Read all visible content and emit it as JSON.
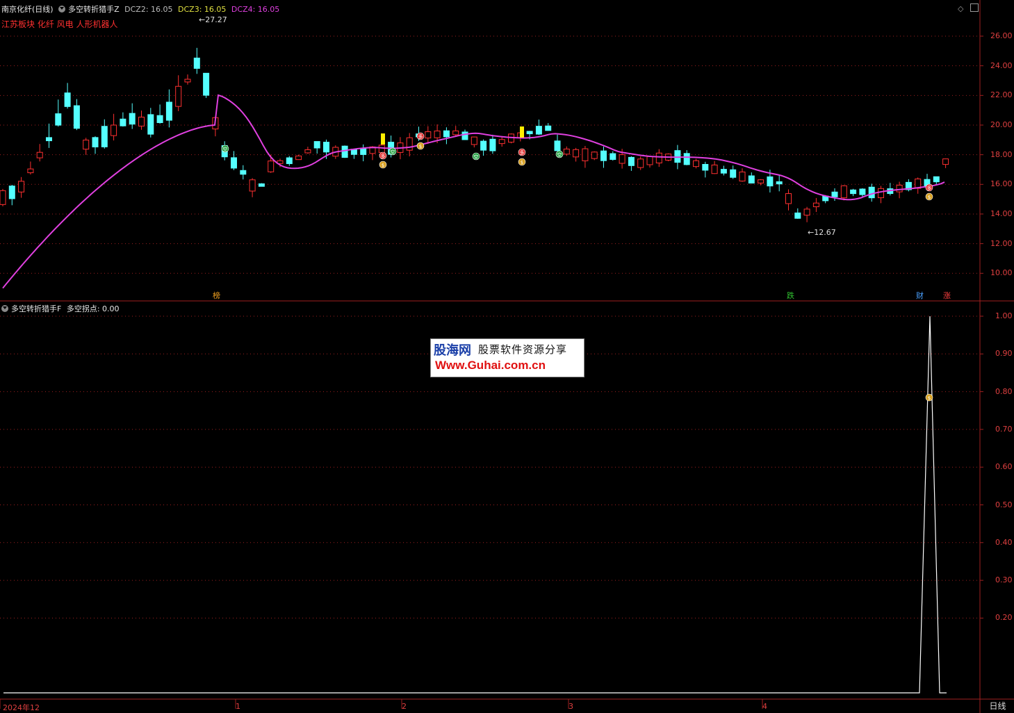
{
  "main_panel": {
    "stock_title": "南京化纤(日线)",
    "indicator_name": "多空转折猎手Z",
    "dcz2": "DCZ2: 16.05",
    "dcz3": "DCZ3: 16.05",
    "dcz4": "DCZ4: 16.05",
    "sector_text": "江苏板块 化纤 风电 人形机器人",
    "high_mark": "27.27",
    "low_mark": "12.67",
    "y_ticks": [
      "26.00",
      "24.00",
      "22.00",
      "20.00",
      "18.00",
      "16.00",
      "14.00",
      "12.00",
      "10.00"
    ],
    "bottom_badges": [
      {
        "text": "榜",
        "color": "#f0a020"
      },
      {
        "text": "跌",
        "color": "#30c030"
      },
      {
        "text": "财",
        "color": "#4aa0ff"
      },
      {
        "text": "涨",
        "color": "#ff4040"
      }
    ],
    "signal_labels": {
      "kong": "空",
      "duo": "多",
      "money": "$"
    }
  },
  "sub_panel": {
    "indicator_name": "多空转折猎手F",
    "value_label": "多空拐点: 0.00",
    "y_ticks": [
      "1.00",
      "0.90",
      "0.80",
      "0.70",
      "0.60",
      "0.50",
      "0.40",
      "0.30",
      "0.20"
    ]
  },
  "x_axis": {
    "labels": [
      "2024年12",
      "1",
      "2",
      "3",
      "4"
    ]
  },
  "period_tab": "日线",
  "watermark": {
    "brand": "股海网",
    "slogan": "股票软件资源分享",
    "url": "Www.Guhai.com.cn"
  },
  "colors": {
    "up": "#ff3030",
    "down": "#54ffff",
    "ma_main": "#e040e0",
    "ma_yellow": "#e0e040",
    "ma_gray": "#a0a0a0",
    "grid": "#a02020",
    "osc_line": "#ffffff"
  }
}
